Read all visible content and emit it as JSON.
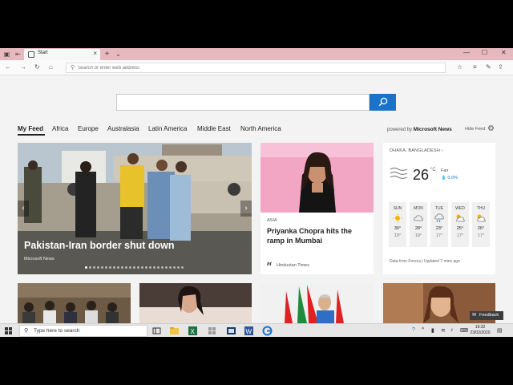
{
  "browser": {
    "tab_title": "Start",
    "tab_close": "×",
    "new_tab": "+",
    "tab_menu": "⌄",
    "address_placeholder": "Search or enter web address"
  },
  "search": {
    "query": ""
  },
  "feed_nav": {
    "items": [
      "My Feed",
      "Africa",
      "Europe",
      "Australasia",
      "Latin America",
      "Middle East",
      "North America"
    ],
    "powered_prefix": "powered by",
    "powered_brand": "Microsoft News",
    "hide_feed": "Hide Feed"
  },
  "hero": {
    "title": "Pakistan-Iran border shut down",
    "source": "Microsoft News",
    "prev": "‹",
    "next": "›"
  },
  "card2": {
    "category": "ASIA",
    "title": "Priyanka Chopra hits the ramp in Mumbai",
    "source_icon": "ht",
    "source": "Hindustan Times"
  },
  "weather": {
    "location": "DHAKA, BANGLADESH ›",
    "temp": "26",
    "unit": "°C",
    "condition": "Fair",
    "rain": "💧 0.0%",
    "days": [
      {
        "day": "SUN",
        "hi": "30°",
        "lo": "19°",
        "icon": "sun-icon"
      },
      {
        "day": "MON",
        "hi": "28°",
        "lo": "19°",
        "icon": "cloud-icon"
      },
      {
        "day": "TUE",
        "hi": "23°",
        "lo": "17°",
        "icon": "cloud-rain-icon"
      },
      {
        "day": "WED",
        "hi": "25°",
        "lo": "17°",
        "icon": "partly-cloudy-icon"
      },
      {
        "day": "THU",
        "hi": "26°",
        "lo": "17°",
        "icon": "partly-cloudy-icon"
      }
    ],
    "footer": "Data from Foreca | Updated 7 mins ago"
  },
  "feedback": {
    "label": "Feedback"
  },
  "taskbar": {
    "search_placeholder": "Type here to search",
    "time": "19:32",
    "date": "23/02/2020"
  },
  "colors": {
    "tabbar": "#e8b8bf",
    "accent": "#1a73c8",
    "page_bg": "#f3f3f3"
  }
}
